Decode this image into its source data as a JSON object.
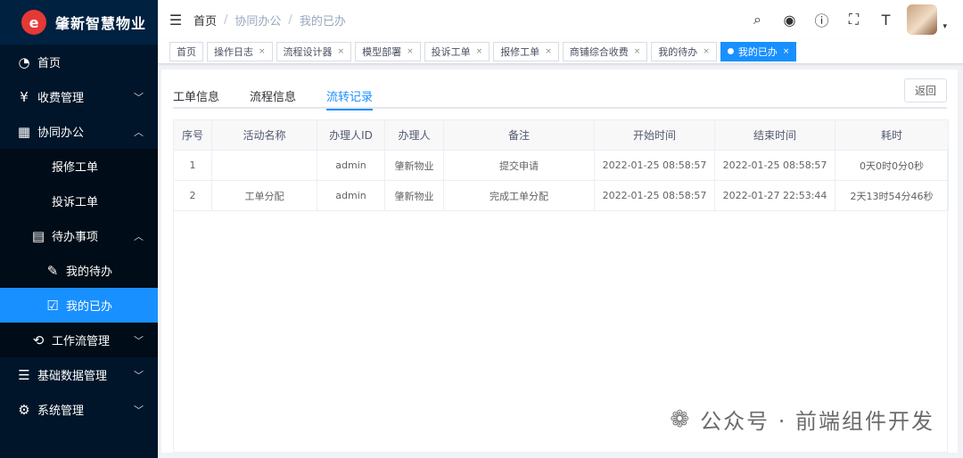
{
  "app": {
    "title": "肇新智慧物业",
    "logo_glyph": "e"
  },
  "sidebar": {
    "items": [
      {
        "label": "首页",
        "icon": "dashboard-icon",
        "glyph": "◔"
      },
      {
        "label": "收费管理",
        "icon": "yen-icon",
        "glyph": "¥",
        "arrow": "﹀"
      },
      {
        "label": "协同办公",
        "icon": "calendar-icon",
        "glyph": "▦",
        "arrow": "︿"
      },
      {
        "label": "报修工单"
      },
      {
        "label": "投诉工单"
      },
      {
        "label": "待办事项",
        "icon": "todo-icon",
        "glyph": "▤",
        "arrow": "︿"
      },
      {
        "label": "我的待办",
        "icon": "edit-icon",
        "glyph": "✎"
      },
      {
        "label": "我的已办",
        "icon": "checkbox-icon",
        "glyph": "☑"
      },
      {
        "label": "工作流管理",
        "icon": "workflow-icon",
        "glyph": "⟲",
        "arrow": "﹀"
      },
      {
        "label": "基础数据管理",
        "icon": "database-icon",
        "glyph": "☰",
        "arrow": "﹀"
      },
      {
        "label": "系统管理",
        "icon": "gear-icon",
        "glyph": "⚙",
        "arrow": "﹀"
      }
    ]
  },
  "header": {
    "menu_toggle_glyph": "☰",
    "breadcrumb": [
      "首页",
      "协同办公",
      "我的已办"
    ],
    "separator": "/",
    "icons": {
      "search": "⌕",
      "github": "◉",
      "help": "ⓘ",
      "fullscreen": "⛶",
      "font": "T"
    },
    "caret": "▾"
  },
  "tags": [
    {
      "label": "首页",
      "closable": false
    },
    {
      "label": "操作日志",
      "closable": true
    },
    {
      "label": "流程设计器",
      "closable": true
    },
    {
      "label": "模型部署",
      "closable": true
    },
    {
      "label": "投诉工单",
      "closable": true
    },
    {
      "label": "报修工单",
      "closable": true
    },
    {
      "label": "商铺综合收费",
      "closable": true
    },
    {
      "label": "我的待办",
      "closable": true
    },
    {
      "label": "我的已办",
      "closable": true,
      "active": true
    }
  ],
  "tag_close_glyph": "×",
  "tabs": [
    {
      "label": "工单信息"
    },
    {
      "label": "流程信息"
    },
    {
      "label": "流转记录",
      "active": true
    }
  ],
  "back_button": "返回",
  "table": {
    "columns": [
      "序号",
      "活动名称",
      "办理人ID",
      "办理人",
      "备注",
      "开始时间",
      "结束时间",
      "耗时"
    ],
    "rows": [
      [
        "1",
        "",
        "admin",
        "肇新物业",
        "提交申请",
        "2022-01-25 08:58:57",
        "2022-01-25 08:58:57",
        "0天0时0分0秒"
      ],
      [
        "2",
        "工单分配",
        "admin",
        "肇新物业",
        "完成工单分配",
        "2022-01-25 08:58:57",
        "2022-01-27 22:53:44",
        "2天13时54分46秒"
      ]
    ]
  },
  "watermark": {
    "text": "公众号 · 前端组件开发",
    "icon_glyph": "❁"
  },
  "colors": {
    "sidebar_bg": "#001529",
    "accent": "#1890ff",
    "logo_red": "#e53935"
  }
}
